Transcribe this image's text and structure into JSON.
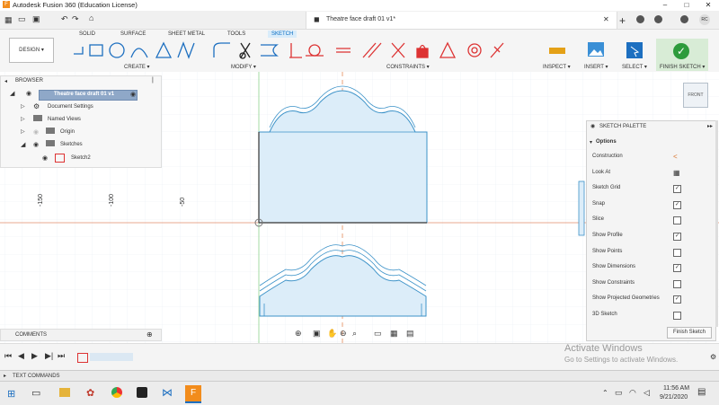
{
  "window": {
    "title": "Autodesk Fusion 360 (Education License)",
    "doc_title": "Theatre face draft 01 v1*"
  },
  "ribbon": {
    "tabs": [
      "SOLID",
      "SURFACE",
      "SHEET METAL",
      "TOOLS",
      "SKETCH"
    ],
    "active_tab": "SKETCH",
    "design_label": "DESIGN ▾",
    "groups": [
      "CREATE ▾",
      "MODIFY ▾",
      "CONSTRAINTS ▾",
      "INSPECT ▾",
      "INSERT ▾",
      "SELECT ▾",
      "FINISH SKETCH ▾"
    ]
  },
  "browser": {
    "header": "BROWSER",
    "root": "Theatre face draft 01 v1",
    "items": [
      "Document Settings",
      "Named Views",
      "Origin",
      "Sketches",
      "Sketch2"
    ]
  },
  "viewcube": {
    "label": "FRONT"
  },
  "ruler": {
    "labels": [
      "-150",
      "-100",
      "-50"
    ]
  },
  "palette": {
    "title": "SKETCH PALETTE",
    "section": "Options",
    "rows": [
      {
        "label": "Construction",
        "kind": "icon",
        "checked": false
      },
      {
        "label": "Look At",
        "kind": "icon",
        "checked": false
      },
      {
        "label": "Sketch Grid",
        "kind": "check",
        "checked": true
      },
      {
        "label": "Snap",
        "kind": "check",
        "checked": true
      },
      {
        "label": "Slice",
        "kind": "check",
        "checked": false
      },
      {
        "label": "Show Profile",
        "kind": "check",
        "checked": true
      },
      {
        "label": "Show Points",
        "kind": "check",
        "checked": false
      },
      {
        "label": "Show Dimensions",
        "kind": "check",
        "checked": true
      },
      {
        "label": "Show Constraints",
        "kind": "check",
        "checked": false
      },
      {
        "label": "Show Projected Geometries",
        "kind": "check",
        "checked": true
      },
      {
        "label": "3D Sketch",
        "kind": "check",
        "checked": false
      }
    ],
    "finish_label": "Finish Sketch"
  },
  "bottom": {
    "comments": "COMMENTS",
    "text_commands": "TEXT COMMANDS",
    "activate_title": "Activate Windows",
    "activate_sub": "Go to Settings to activate Windows."
  },
  "taskbar": {
    "time": "11:56 AM",
    "date": "9/21/2020",
    "user": "RC"
  }
}
